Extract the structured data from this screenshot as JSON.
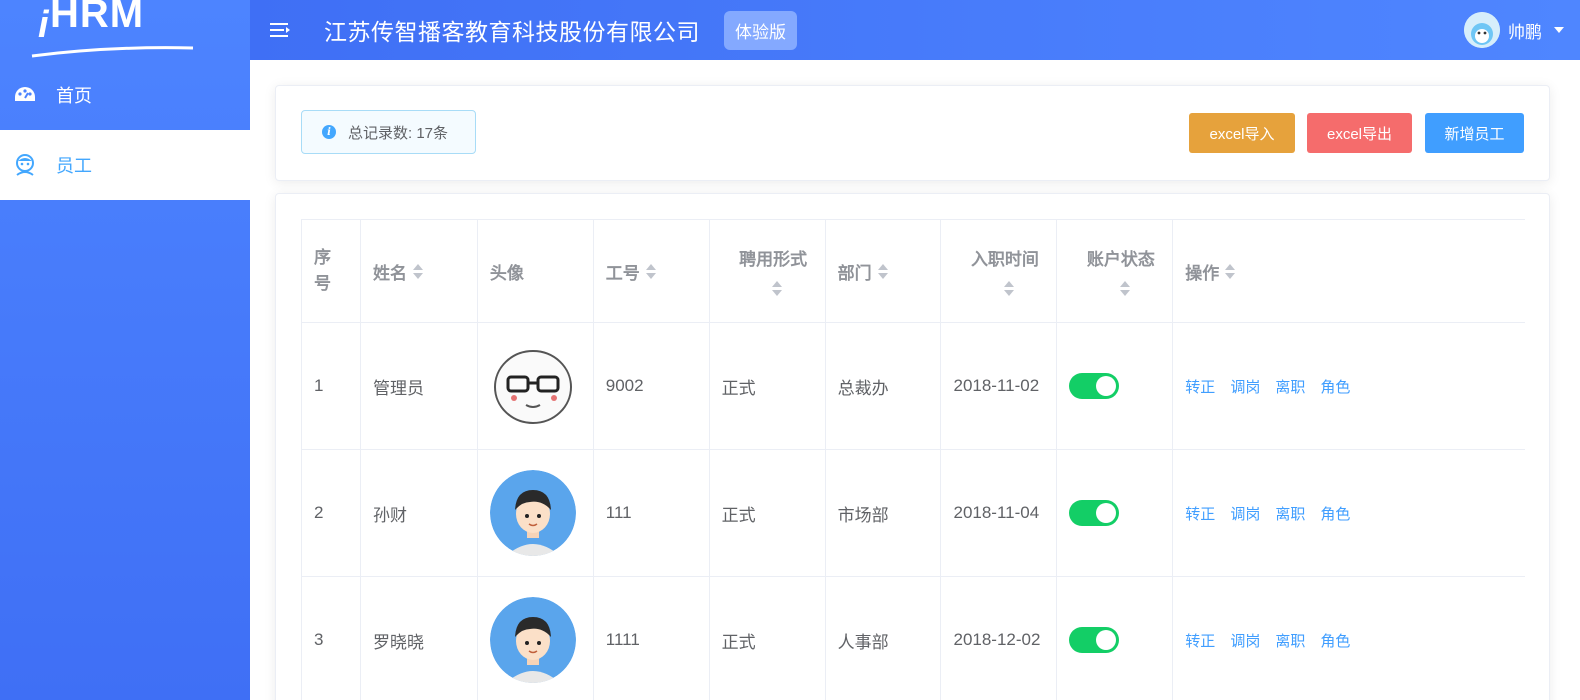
{
  "app": {
    "logo": "HRM"
  },
  "sidebar": {
    "items": [
      {
        "label": "首页"
      },
      {
        "label": "员工"
      }
    ]
  },
  "header": {
    "company": "江苏传智播客教育科技股份有限公司",
    "badge": "体验版",
    "username": "帅鹏"
  },
  "toolbar": {
    "total_records": "总记录数: 17条",
    "import_label": "excel导入",
    "export_label": "excel导出",
    "add_label": "新增员工"
  },
  "table": {
    "headers": [
      "序号",
      "姓名",
      "头像",
      "工号",
      "聘用形式",
      "部门",
      "入职时间",
      "账户状态",
      "操作"
    ],
    "operations": [
      "转正",
      "调岗",
      "离职",
      "角色"
    ],
    "rows": [
      {
        "index": "1",
        "name": "管理员",
        "avatar": "meme-face",
        "work_no": "9002",
        "employment": "正式",
        "department": "总裁办",
        "hire_date": "2018-11-02",
        "enabled": true
      },
      {
        "index": "2",
        "name": "孙财",
        "avatar": "cartoon-boy",
        "work_no": "111",
        "employment": "正式",
        "department": "市场部",
        "hire_date": "2018-11-04",
        "enabled": true
      },
      {
        "index": "3",
        "name": "罗晓晓",
        "avatar": "cartoon-boy",
        "work_no": "1111",
        "employment": "正式",
        "department": "人事部",
        "hire_date": "2018-12-02",
        "enabled": true
      }
    ]
  },
  "colors": {
    "accent": "#409eff",
    "sidebar": "#4d84ff",
    "switch_on": "#13ce66",
    "import": "#e6a23c",
    "export": "#f56c6c"
  }
}
